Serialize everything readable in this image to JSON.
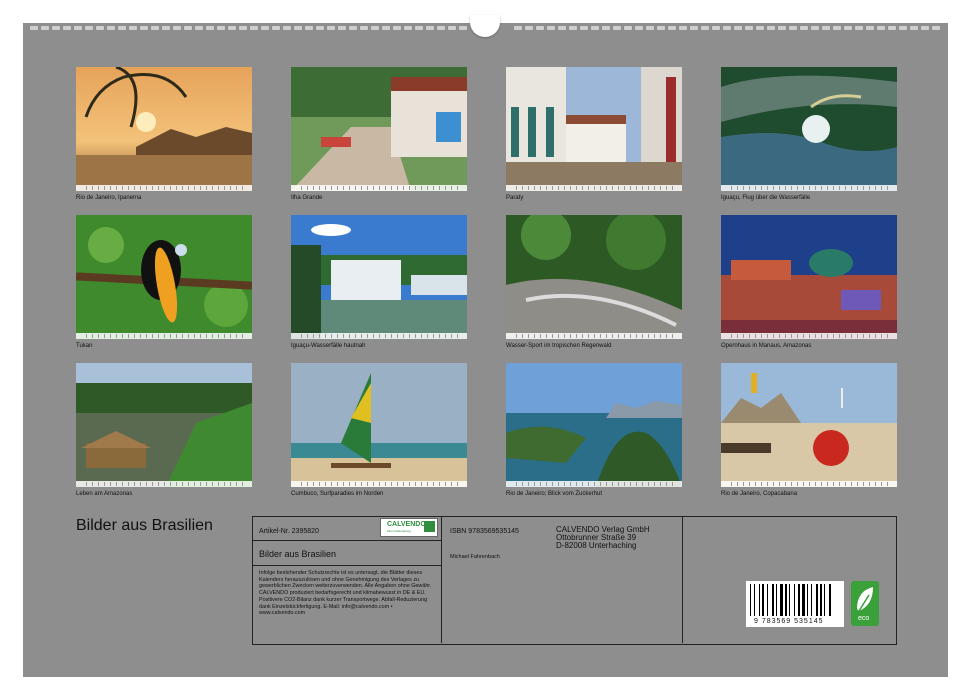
{
  "photos": [
    {
      "caption": "Rio de Janeiro, Ipanema"
    },
    {
      "caption": "Ilha Grande"
    },
    {
      "caption": "Paraty"
    },
    {
      "caption": "Iguaçu, Flug über die Wasserfälle"
    },
    {
      "caption": "Tukan"
    },
    {
      "caption": "Iguaçu-Wasserfälle hautnah"
    },
    {
      "caption": "Wasser-Sport im tropischen Regenwald"
    },
    {
      "caption": "Opernhaus in Manaus, Amazonas"
    },
    {
      "caption": "Leben am Amazonas"
    },
    {
      "caption": "Cumbuco, Surfparadies im Norden"
    },
    {
      "caption": "Rio de Janeiro; Blick vom Zuckerhut"
    },
    {
      "caption": "Rio de Janeiro, Copacabana"
    }
  ],
  "calendar_title": "Bilder aus Brasilien",
  "info": {
    "article_no": "Artikel-Nr. 2395820",
    "title": "Bilder aus Brasilien",
    "legal": "Infolge bestehender Schutzrechte ist es untersagt, die Blätter dieses Kalenders herauszulösen und ohne Genehmigung des Verlages zu gewerblichen Zwecken weiterzuverwenden. Alle Angaben ohne Gewähr. CALVENDO produziert bedarfsgerecht und klimabewusst in DE & EU. Positivere CO2-Bilanz dank kurzer Transportwege. Abfall-Reduzierung dank Einzelstückfertigung. E-Mail: info@calvendo.com • www.calvendo.com",
    "isbn": "ISBN 9783569535145",
    "author": "Michael Fahrenbach",
    "publisher_line1": "CALVENDO Verlag GmbH",
    "publisher_line2": "Ottobrunner Straße 39",
    "publisher_line3": "D-82008 Unterhaching",
    "barcode_number": "9 783569 535145",
    "logo_name": "CALVENDO",
    "logo_sub": "Mein Kalendertag",
    "eco_label": "eco"
  },
  "colors": {
    "background": "#8e8e8e",
    "eco_green": "#3aa03a"
  }
}
